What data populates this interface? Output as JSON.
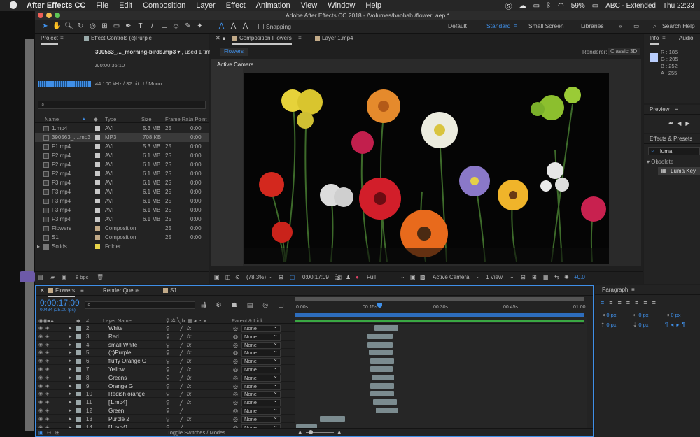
{
  "menubar": {
    "app": "After Effects CC",
    "items": [
      "File",
      "Edit",
      "Composition",
      "Layer",
      "Effect",
      "Animation",
      "View",
      "Window",
      "Help"
    ],
    "battery": "59%",
    "input": "ABC - Extended",
    "clock": "Thu 22:33"
  },
  "window": {
    "title": "Adobe After Effects CC 2018 - /Volumes/baobab /flower .aep *"
  },
  "toolbar": {
    "snapping": "Snapping",
    "workspaces": [
      "Default",
      "Standard",
      "Small Screen",
      "Libraries"
    ],
    "active_workspace": "Standard",
    "search": "Search Help"
  },
  "project": {
    "tab": "Project",
    "effect_tab": "Effect Controls (c)Purple",
    "selected_name": "390563_..._morning-birds.mp3",
    "used": ", used 1 time",
    "duration": "Δ 0:00:36:10",
    "audio_info": "44.100 kHz / 32 bit U / Mono",
    "columns": {
      "name": "Name",
      "type": "Type",
      "size": "Size",
      "rate": "Frame Ra...",
      "in": "In Point"
    },
    "bpc": "8 bpc",
    "items": [
      {
        "name": "1.mp4",
        "type": "AVI",
        "size": "5.3 MB",
        "rate": "25",
        "in": "0:00",
        "color": "#c8c8c8"
      },
      {
        "name": "390563_....mp3",
        "type": "MP3",
        "size": "708 KB",
        "rate": "",
        "in": "0:00",
        "color": "#c8c8c8"
      },
      {
        "name": "F1.mp4",
        "type": "AVI",
        "size": "5.3 MB",
        "rate": "25",
        "in": "0:00",
        "color": "#c8c8c8"
      },
      {
        "name": "F2.mp4",
        "type": "AVI",
        "size": "6.1 MB",
        "rate": "25",
        "in": "0:00",
        "color": "#c8c8c8"
      },
      {
        "name": "F2.mp4",
        "type": "AVI",
        "size": "6.1 MB",
        "rate": "25",
        "in": "0:00",
        "color": "#c8c8c8"
      },
      {
        "name": "F2.mp4",
        "type": "AVI",
        "size": "6.1 MB",
        "rate": "25",
        "in": "0:00",
        "color": "#c8c8c8"
      },
      {
        "name": "F3.mp4",
        "type": "AVI",
        "size": "6.1 MB",
        "rate": "25",
        "in": "0:00",
        "color": "#c8c8c8"
      },
      {
        "name": "F3.mp4",
        "type": "AVI",
        "size": "6.1 MB",
        "rate": "25",
        "in": "0:00",
        "color": "#c8c8c8"
      },
      {
        "name": "F3.mp4",
        "type": "AVI",
        "size": "6.1 MB",
        "rate": "25",
        "in": "0:00",
        "color": "#c8c8c8"
      },
      {
        "name": "F3.mp4",
        "type": "AVI",
        "size": "6.1 MB",
        "rate": "25",
        "in": "0:00",
        "color": "#c8c8c8"
      },
      {
        "name": "F3.mp4",
        "type": "AVI",
        "size": "6.1 MB",
        "rate": "25",
        "in": "0:00",
        "color": "#c8c8c8"
      },
      {
        "name": "Flowers",
        "type": "Composition",
        "size": "",
        "rate": "25",
        "in": "0:00",
        "color": "#c2aa88"
      },
      {
        "name": "S1",
        "type": "Composition",
        "size": "",
        "rate": "25",
        "in": "0:00",
        "color": "#c2aa88"
      },
      {
        "name": "Solids",
        "type": "Folder",
        "size": "",
        "rate": "",
        "in": "",
        "color": "#e8d44a"
      }
    ]
  },
  "composition": {
    "tab": "Composition Flowers",
    "layer_tab": "Layer 1.mp4",
    "crumb": "Flowers",
    "renderer_label": "Renderer:",
    "renderer": "Classic 3D",
    "camera_label": "Active Camera",
    "zoom": "(78.3%)",
    "time": "0:00:17:09",
    "quality": "Full",
    "camera": "Active Camera",
    "views": "1 View",
    "exposure": "+0.0"
  },
  "info": {
    "tab": "Info",
    "audio_tab": "Audio",
    "r": "R : 185",
    "g": "G : 205",
    "b": "B : 252",
    "a": "A : 255",
    "swatch": "#b9cdfc"
  },
  "preview": {
    "tab": "Preview"
  },
  "effects": {
    "tab": "Effects & Presets",
    "query": "luma",
    "category": "Obsolete",
    "result": "Luma Key"
  },
  "timeline": {
    "tabs": [
      "Flowers",
      "Render Queue",
      "S1"
    ],
    "timecode": "0:00:17:09",
    "frames": "00434 (25.00 fps)",
    "col_layer": "Layer Name",
    "col_parent": "Parent & Link",
    "ruler": [
      "0:00s",
      "00:15s",
      "00:30s",
      "00:45s",
      "01:00"
    ],
    "toggle": "Toggle Switches / Modes",
    "layers": [
      {
        "num": "2",
        "name": "White",
        "fx": "fx",
        "parent": "None"
      },
      {
        "num": "3",
        "name": "Red",
        "fx": "fx",
        "parent": "None"
      },
      {
        "num": "4",
        "name": "small White",
        "fx": "fx",
        "parent": "None"
      },
      {
        "num": "5",
        "name": "(c)Purple",
        "fx": "fx",
        "parent": "None"
      },
      {
        "num": "6",
        "name": "fluffy Orange G",
        "fx": "fx",
        "parent": "None"
      },
      {
        "num": "7",
        "name": "Yellow",
        "fx": "fx",
        "parent": "None"
      },
      {
        "num": "8",
        "name": "Greens",
        "fx": "fx",
        "parent": "None"
      },
      {
        "num": "9",
        "name": "Orange G",
        "fx": "fx",
        "parent": "None"
      },
      {
        "num": "10",
        "name": "Redish orange",
        "fx": "fx",
        "parent": "None"
      },
      {
        "num": "11",
        "name": "[1.mp4]",
        "fx": "fx",
        "parent": "None"
      },
      {
        "num": "12",
        "name": "Green",
        "fx": "",
        "parent": "None"
      },
      {
        "num": "13",
        "name": "Purple 2",
        "fx": "fx",
        "parent": "None"
      },
      {
        "num": "14",
        "name": "[1.mp4]",
        "fx": "",
        "parent": "None"
      }
    ]
  },
  "paragraph": {
    "tab": "Paragraph",
    "indent_left": "0 px",
    "indent_right": "0 px",
    "space_before": "0 px",
    "space_after": "0 px",
    "indent_first": "0 px"
  }
}
